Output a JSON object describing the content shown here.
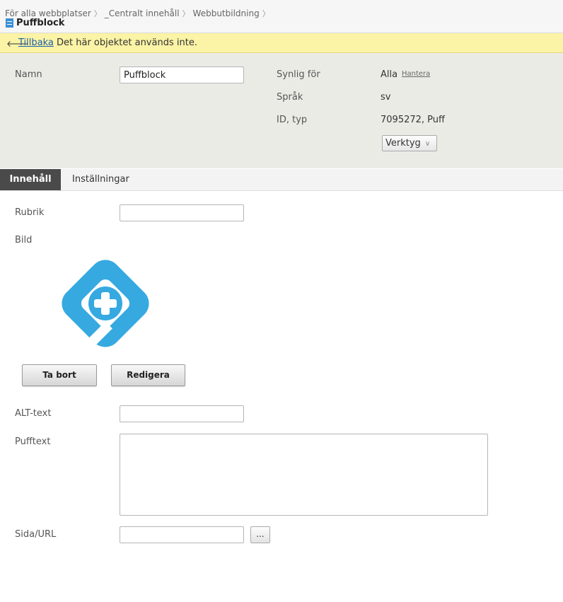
{
  "breadcrumb": [
    "För alla webbplatser",
    "_Centralt innehåll",
    "Webbutbildning"
  ],
  "page_title": "Puffblock",
  "notice": {
    "link": "Tillbaka",
    "text": "Det här objektet används inte."
  },
  "props": {
    "name_label": "Namn",
    "name_value": "Puffblock",
    "visible_label": "Synlig för",
    "visible_value": "Alla",
    "manage_link": "Hantera",
    "lang_label": "Språk",
    "lang_value": "sv",
    "id_label": "ID, typ",
    "id_value": "7095272, Puff",
    "tools_label": "Verktyg"
  },
  "tabs": [
    {
      "label": "Innehåll",
      "active": true
    },
    {
      "label": "Inställningar",
      "active": false
    }
  ],
  "form": {
    "rubrik_label": "Rubrik",
    "rubrik_value": "",
    "bild_label": "Bild",
    "remove_button": "Ta bort",
    "edit_button": "Redigera",
    "alt_label": "ALT-text",
    "alt_value": "",
    "pufftext_label": "Pufftext",
    "url_label": "Sida/URL",
    "url_value": "",
    "browse_button": "..."
  },
  "colors": {
    "accent_blue": "#36a9e1",
    "notice_bg": "#fbf3a5",
    "panel_bg": "#ebebe6",
    "active_tab": "#4a4a4a"
  }
}
